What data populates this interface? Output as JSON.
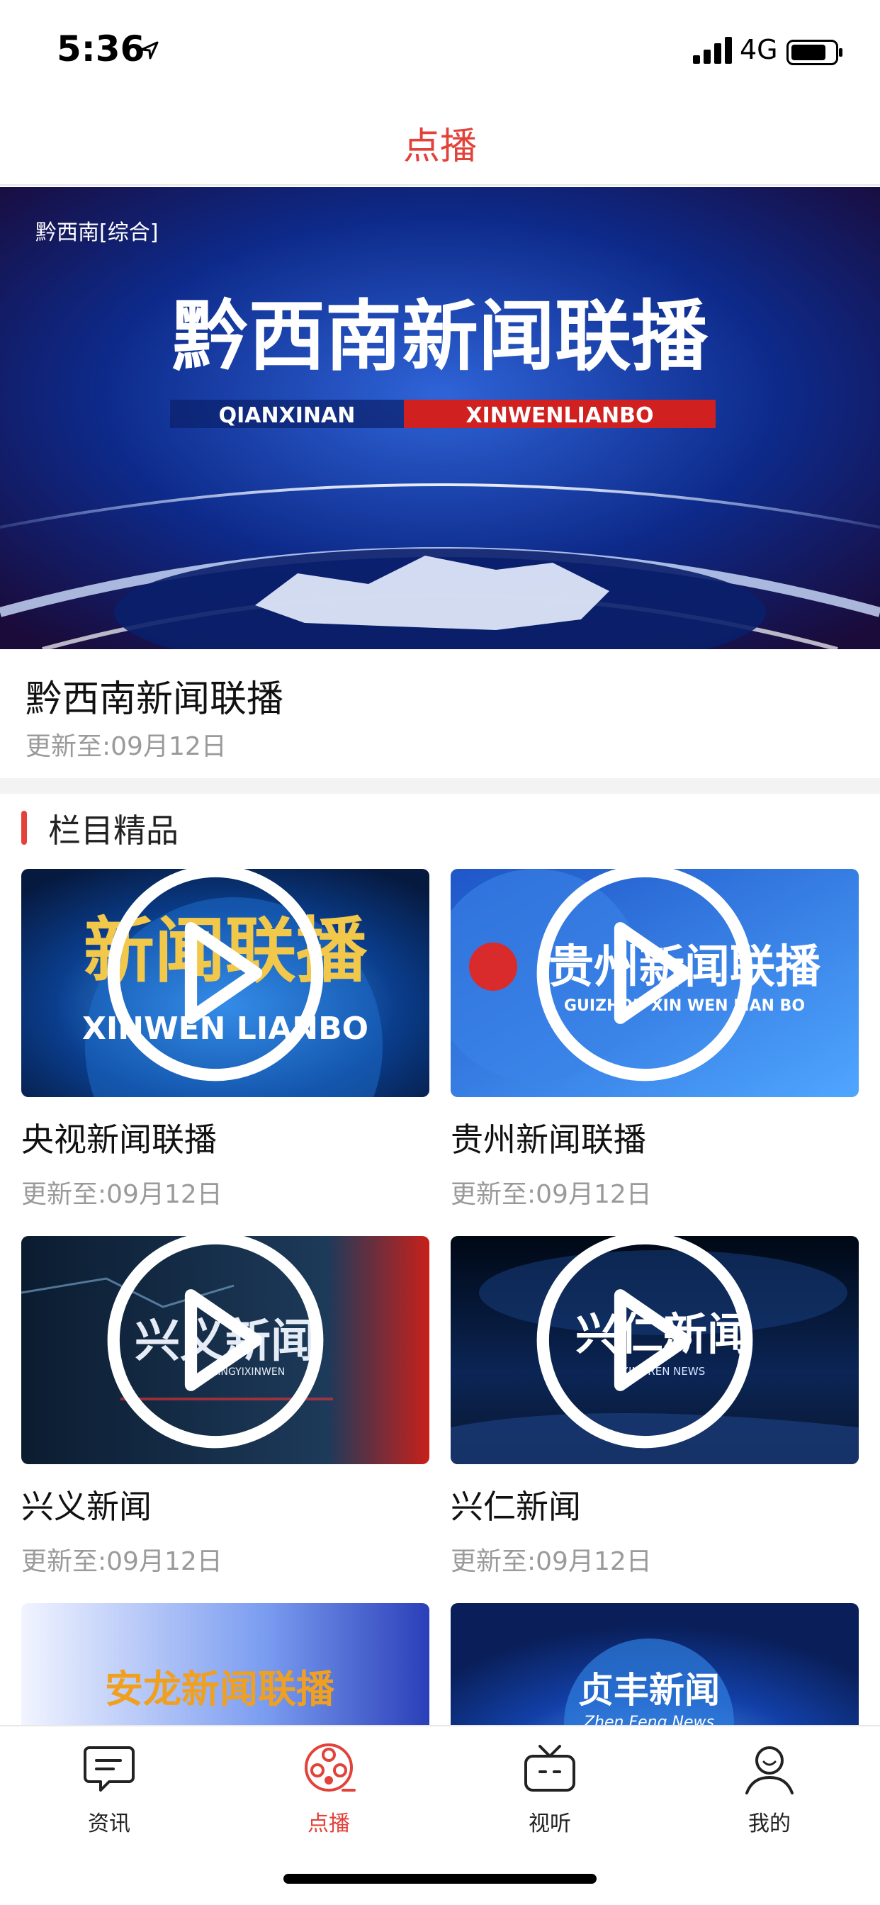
{
  "status": {
    "time": "5:36",
    "network": "4G"
  },
  "nav": {
    "title": "点播"
  },
  "hero": {
    "title": "黔西南新闻联播",
    "update": "更新至:09月12日",
    "image_logo": "黔西南[综合]",
    "image_title": "黔西南新闻联播",
    "image_subtitle_a": "QIANXINAN",
    "image_subtitle_b": "XINWENLIANBO"
  },
  "section": {
    "title": "栏目精品"
  },
  "cards": [
    {
      "title": "央视新闻联播",
      "update": "更新至:09月12日",
      "thumb_text": "新闻联播",
      "thumb_sub": "XINWEN LIANBO"
    },
    {
      "title": "贵州新闻联播",
      "update": "更新至:09月12日",
      "thumb_text": "贵州新闻联播",
      "thumb_sub": "GUIZHOU XIN WEN LIAN BO"
    },
    {
      "title": "兴义新闻",
      "update": "更新至:09月12日",
      "thumb_text": "兴义新闻",
      "thumb_sub": "XINGYIXINWEN"
    },
    {
      "title": "兴仁新闻",
      "update": "更新至:09月12日",
      "thumb_text": "兴仁新闻",
      "thumb_sub": "XINGREN NEWS"
    },
    {
      "thumb_text": "安龙新闻联播"
    },
    {
      "thumb_text": "贞丰新闻",
      "thumb_sub": "Zhen Feng News"
    }
  ],
  "tabs": [
    {
      "label": "资讯",
      "icon": "news-icon"
    },
    {
      "label": "点播",
      "icon": "film-reel-icon",
      "active": true
    },
    {
      "label": "视听",
      "icon": "tv-icon"
    },
    {
      "label": "我的",
      "icon": "user-icon"
    }
  ],
  "colors": {
    "accent": "#e2423a",
    "muted": "#9a9a9a"
  }
}
